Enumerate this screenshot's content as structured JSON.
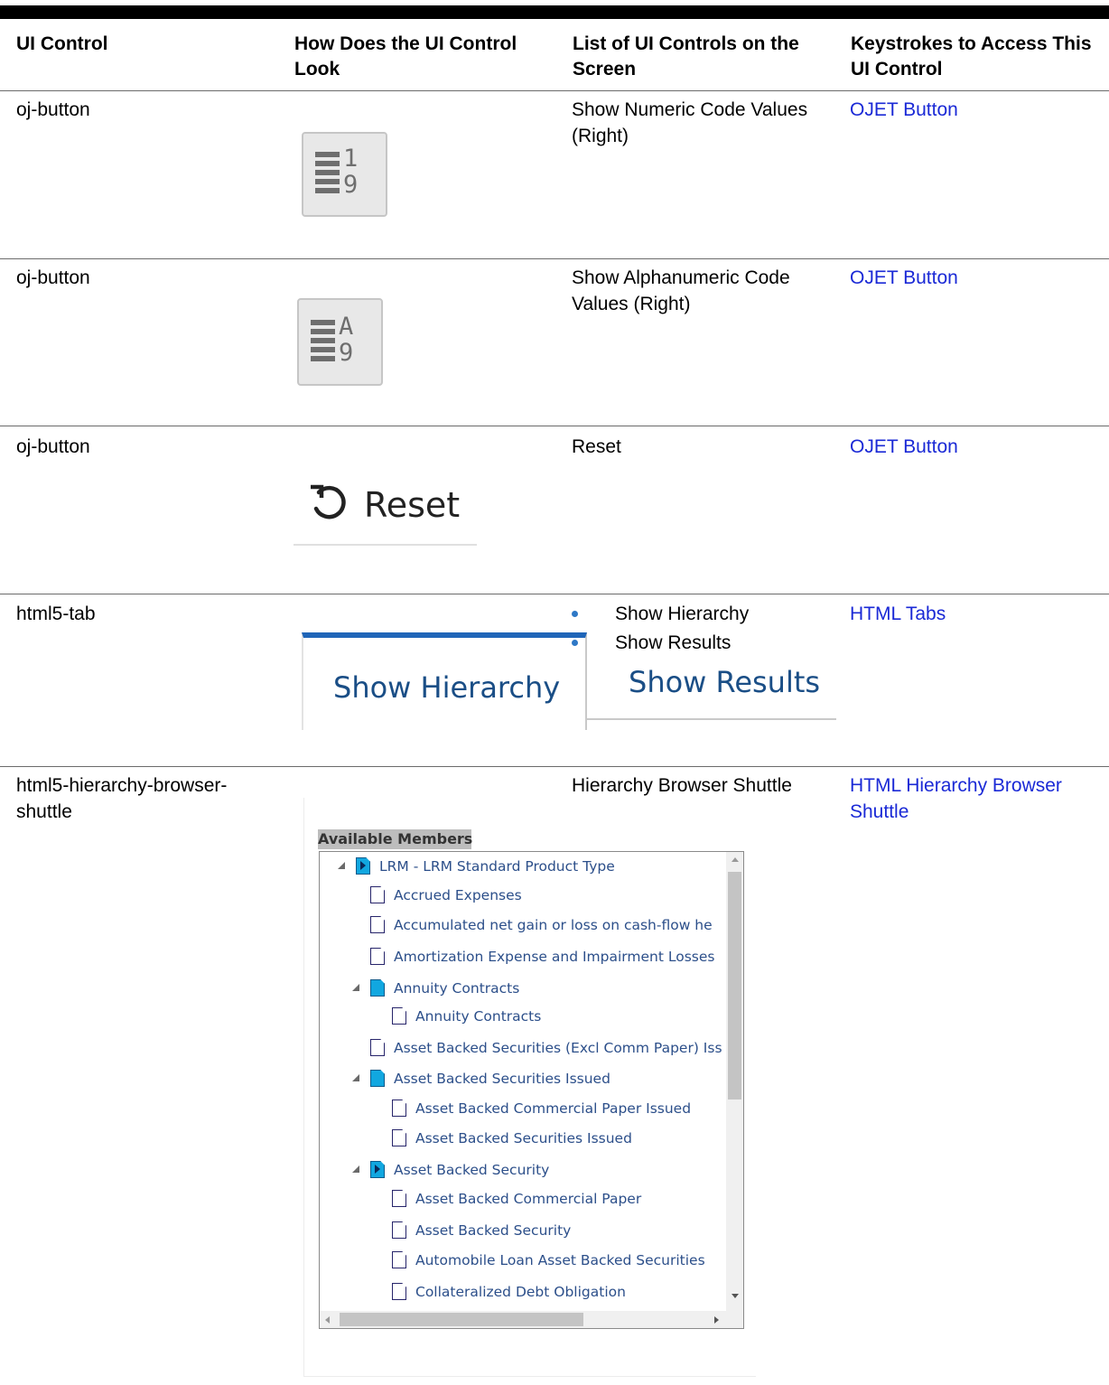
{
  "headers": {
    "col1": "UI Control",
    "col2": "How Does the UI Control Look",
    "col3": "List of UI Controls on the Screen",
    "col4": "Keystrokes to Access This UI Control"
  },
  "rows": [
    {
      "control": "oj-button",
      "list": "Show Numeric Code Values (Right)",
      "keystroke": "OJET Button",
      "icon": "numeric-code-icon",
      "glyph_top": "1",
      "glyph_bottom": "9"
    },
    {
      "control": "oj-button",
      "list": "Show Alphanumeric Code Values (Right)",
      "keystroke": "OJET Button",
      "icon": "alphanumeric-code-icon",
      "glyph_top": "A",
      "glyph_bottom": "9"
    },
    {
      "control": "oj-button",
      "list": "Reset",
      "keystroke": "OJET Button",
      "button_label": "Reset",
      "icon": "reset-icon"
    },
    {
      "control": "html5-tab",
      "list_items": [
        "Show Hierarchy",
        "Show Results"
      ],
      "keystroke": "HTML Tabs",
      "tabs": [
        "Show Hierarchy",
        "Show Results"
      ]
    },
    {
      "control": "html5-hierarchy-browser-shuttle",
      "list": "Hierarchy Browser Shuttle",
      "keystroke": "HTML Hierarchy Browser Shuttle"
    }
  ],
  "hierarchy": {
    "title": "Available Members",
    "nodes": [
      "LRM - LRM Standard Product Type",
      "Accrued Expenses",
      "Accumulated net gain or loss on cash-flow he",
      "Amortization Expense and Impairment Losses",
      "Annuity Contracts",
      "Annuity Contracts",
      "Asset Backed Securities (Excl Comm Paper) Iss",
      "Asset Backed Securities Issued",
      "Asset Backed Commercial Paper Issued",
      "Asset Backed Securities Issued",
      "Asset Backed Security",
      "Asset Backed Commercial Paper",
      "Asset Backed Security",
      "Automobile Loan Asset Backed Securities",
      "Collateralized Debt Obligation"
    ]
  },
  "colors": {
    "link": "#1a29d6",
    "tab_accent": "#1f65b8",
    "tree_text": "#2c4f8a",
    "folder_blue": "#11a7e0"
  }
}
